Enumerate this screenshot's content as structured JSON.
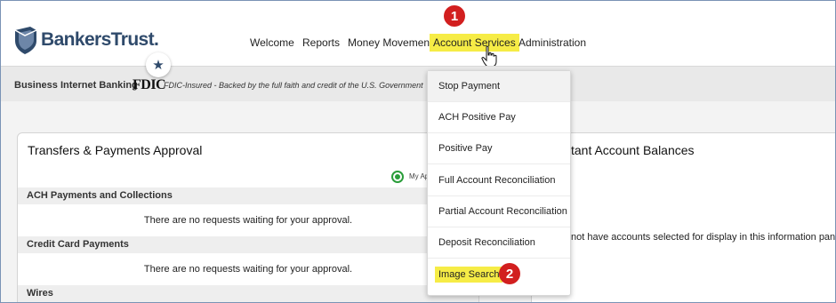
{
  "brand": {
    "name": "BankersTrust",
    "name_suffix": "."
  },
  "nav": {
    "items": [
      {
        "label": "Welcome"
      },
      {
        "label": "Reports"
      },
      {
        "label": "Money Movement"
      },
      {
        "label": "Account Services"
      },
      {
        "label": "Administration"
      }
    ],
    "active_index": 3
  },
  "step_badges": {
    "one": "1",
    "two": "2"
  },
  "subbar": {
    "title": "Business Internet Banking",
    "fdic_logo": "FDIC",
    "fdic_text": "FDIC-Insured - Backed by the full faith and credit of the U.S. Government"
  },
  "left_panel": {
    "title": "Transfers & Payments Approval",
    "radio_label": "My Ap",
    "sections": [
      {
        "title": "ACH Payments and Collections",
        "message": "There are no requests waiting for your approval."
      },
      {
        "title": "Credit Card Payments",
        "message": "There are no requests waiting for your approval."
      },
      {
        "title": "Wires"
      }
    ]
  },
  "right_panel": {
    "title": "tant Account Balances",
    "message": "not have accounts selected for display in this information panel."
  },
  "dropdown": {
    "items": [
      {
        "label": "Stop Payment"
      },
      {
        "label": "ACH Positive Pay"
      },
      {
        "label": "Positive Pay"
      },
      {
        "label": "Full Account Reconciliation"
      },
      {
        "label": "Partial Account Reconciliation"
      },
      {
        "label": "Deposit Reconciliation"
      },
      {
        "label": "Image Search"
      }
    ],
    "hovered_index": 0,
    "highlighted_index": 6
  },
  "colors": {
    "brand_navy": "#2f4a6b",
    "highlight_yellow": "#f6ec46",
    "badge_red": "#d21f1f",
    "radio_green": "#2a9d3a"
  }
}
